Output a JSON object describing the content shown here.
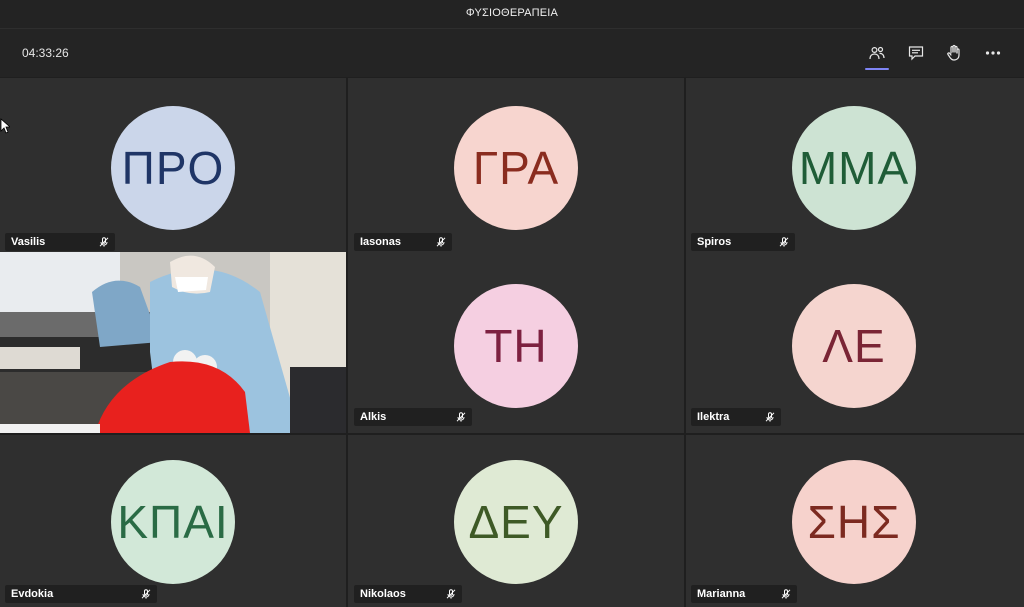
{
  "window": {
    "title": "ΦΥΣΙΟΘΕΡΑΠΕΙΑ"
  },
  "toolbar": {
    "timer": "04:33:26",
    "buttons": [
      {
        "icon": "people-icon",
        "active": true
      },
      {
        "icon": "chat-icon",
        "active": false
      },
      {
        "icon": "raise-hand-icon",
        "active": false
      },
      {
        "icon": "more-options-icon",
        "active": false
      }
    ]
  },
  "participants": [
    {
      "name": "Vasilis",
      "initials": "ΠΡΟ",
      "bg": "#cbd6ea",
      "fg": "#1f3566",
      "muted": true
    },
    {
      "name": "Iasonas",
      "initials": "ΓΡΑ",
      "bg": "#f7d5cf",
      "fg": "#8a2c1f",
      "muted": true
    },
    {
      "name": "Spiros",
      "initials": "ΜΜΑ",
      "bg": "#cde3d3",
      "fg": "#1f5d37",
      "muted": true
    },
    {
      "name": "",
      "initials": "",
      "video": true,
      "muted": false
    },
    {
      "name": "Alkis",
      "initials": "ΤΗ",
      "bg": "#f5cfe1",
      "fg": "#7d2040",
      "muted": true
    },
    {
      "name": "Ilektra",
      "initials": "ΛΕ",
      "bg": "#f5d5cf",
      "fg": "#7a2535",
      "muted": true
    },
    {
      "name": "Evdokia",
      "initials": "ΚΠΑΙ",
      "bg": "#d2e8d8",
      "fg": "#2a6b45",
      "muted": true
    },
    {
      "name": "Nikolaos",
      "initials": "ΔΕΥ",
      "bg": "#dfead4",
      "fg": "#3e5a26",
      "muted": true
    },
    {
      "name": "Marianna",
      "initials": "ΣΗΣ",
      "bg": "#f6d2cc",
      "fg": "#7c2a20",
      "muted": true
    }
  ]
}
